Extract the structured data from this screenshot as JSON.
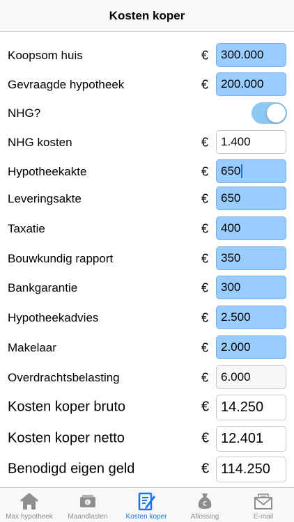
{
  "navbar": {
    "title": "Kosten koper"
  },
  "currency_symbol": "€",
  "rows": {
    "koopsom": {
      "label": "Koopsom huis",
      "value": "300.000"
    },
    "hypotheek": {
      "label": "Gevraagde hypotheek",
      "value": "200.000"
    },
    "nhg": {
      "label": "NHG?",
      "toggle_on": true
    },
    "nhg_kosten": {
      "label": "NHG kosten",
      "value": "1.400"
    },
    "hypotheekakte": {
      "label": "Hypotheekakte",
      "value": "650"
    },
    "leveringsakte": {
      "label": "Leveringsakte",
      "value": "650"
    },
    "taxatie": {
      "label": "Taxatie",
      "value": "400"
    },
    "bouwkundig": {
      "label": "Bouwkundig rapport",
      "value": "350"
    },
    "bankgarantie": {
      "label": "Bankgarantie",
      "value": "300"
    },
    "hypotheekadvies": {
      "label": "Hypotheekadvies",
      "value": "2.500"
    },
    "makelaar": {
      "label": "Makelaar",
      "value": "2.000"
    },
    "overdracht": {
      "label": "Overdrachtsbelasting",
      "value": "6.000"
    },
    "bruto": {
      "label": "Kosten koper bruto",
      "value": "14.250"
    },
    "netto": {
      "label": "Kosten koper netto",
      "value": "12.401"
    },
    "eigen_geld": {
      "label": "Benodigd eigen geld",
      "value": "114.250"
    }
  },
  "colors": {
    "editable_field": "#99ccff",
    "toggle_on": "#8cc8f2",
    "active_tab": "#1a73e8",
    "inactive_tab": "#8e8e8e"
  },
  "tabbar": {
    "tabs": [
      {
        "label": "Max hypotheek",
        "icon": "house-icon",
        "active": false
      },
      {
        "label": "Maandlasten",
        "icon": "wallet-icon",
        "active": false
      },
      {
        "label": "Kosten koper",
        "icon": "document-edit-icon",
        "active": true
      },
      {
        "label": "Aflossing",
        "icon": "euro-bag-icon",
        "active": false
      },
      {
        "label": "E-mail",
        "icon": "envelope-icon",
        "active": false
      }
    ]
  }
}
